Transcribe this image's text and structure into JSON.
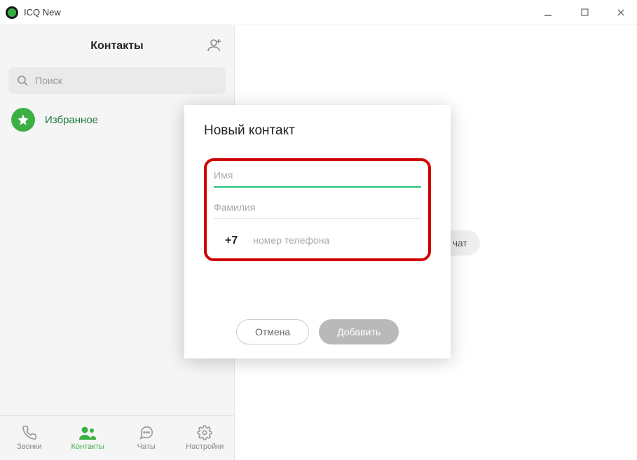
{
  "window": {
    "title": "ICQ New"
  },
  "sidebar": {
    "title": "Контакты",
    "search_placeholder": "Поиск",
    "favorites_label": "Избранное"
  },
  "nav": {
    "calls": "Звонки",
    "contacts": "Контакты",
    "chats": "Чаты",
    "settings": "Настройки"
  },
  "main": {
    "select_chat_hint": "Выберите чат"
  },
  "modal": {
    "title": "Новый контакт",
    "first_name_placeholder": "Имя",
    "first_name_value": "",
    "last_name_placeholder": "Фамилия",
    "last_name_value": "",
    "country_code": "+7",
    "phone_placeholder": "номер телефона",
    "phone_value": "",
    "cancel": "Отмена",
    "add": "Добавить"
  }
}
